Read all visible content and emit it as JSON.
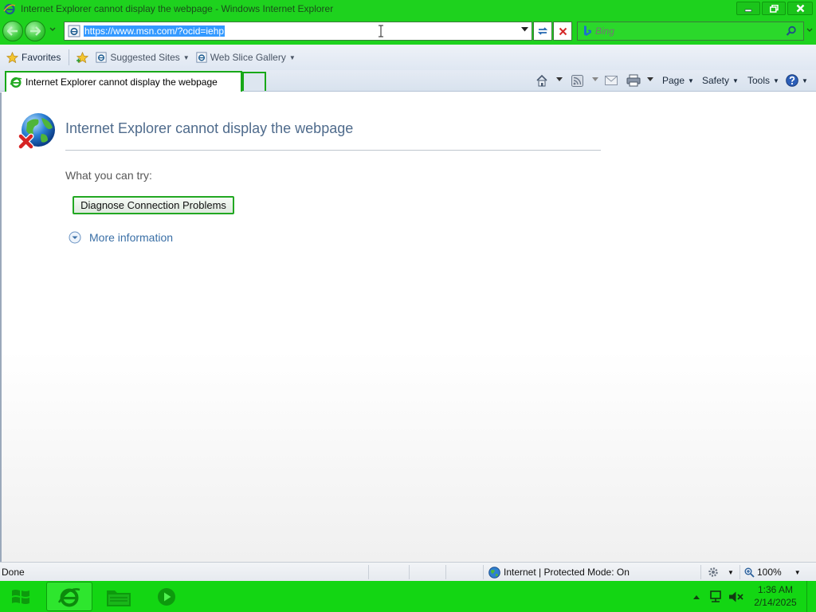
{
  "window": {
    "title": "Internet Explorer cannot display the webpage - Windows Internet Explorer"
  },
  "address_bar": {
    "url": "https://www.msn.com/?ocid=iehp"
  },
  "search": {
    "placeholder": "Bing"
  },
  "favorites_bar": {
    "favorites_label": "Favorites",
    "items": [
      {
        "label": "Suggested Sites"
      },
      {
        "label": "Web Slice Gallery"
      }
    ]
  },
  "tabs": [
    {
      "label": "Internet Explorer cannot display the webpage"
    }
  ],
  "command_bar": {
    "page_label": "Page",
    "safety_label": "Safety",
    "tools_label": "Tools"
  },
  "content": {
    "title": "Internet Explorer cannot display the webpage",
    "what_you_can_try": "What you can try:",
    "diagnose_button": "Diagnose Connection Problems",
    "more_information": "More information"
  },
  "status_bar": {
    "status_text": "Done",
    "zone_text": "Internet | Protected Mode: On",
    "zoom": "100%"
  },
  "taskbar": {
    "time": "1:36 AM",
    "date": "2/14/2025"
  },
  "colors": {
    "chrome_green": "#1ed21e",
    "taskbar_green": "#13d613",
    "title_text": "#4f6b8c",
    "link_blue": "#3a6fa6",
    "selection_blue": "#3399ff"
  }
}
